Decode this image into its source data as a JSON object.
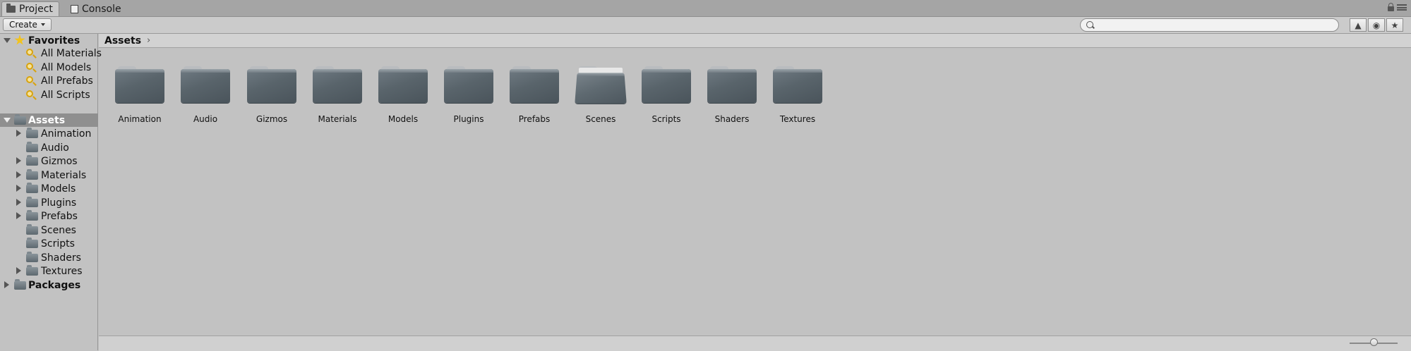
{
  "tabs": [
    {
      "label": "Project",
      "icon": "folder-icon",
      "active": true
    },
    {
      "label": "Console",
      "icon": "console-icon",
      "active": false
    }
  ],
  "toolbar": {
    "create_label": "Create",
    "search_placeholder": "",
    "search_value": ""
  },
  "tree": {
    "favorites": {
      "label": "Favorites",
      "items": [
        "All Materials",
        "All Models",
        "All Prefabs",
        "All Scripts"
      ]
    },
    "assets": {
      "label": "Assets",
      "children": [
        {
          "label": "Animation",
          "expandable": true
        },
        {
          "label": "Audio",
          "expandable": false
        },
        {
          "label": "Gizmos",
          "expandable": true
        },
        {
          "label": "Materials",
          "expandable": true
        },
        {
          "label": "Models",
          "expandable": true
        },
        {
          "label": "Plugins",
          "expandable": true
        },
        {
          "label": "Prefabs",
          "expandable": true
        },
        {
          "label": "Scenes",
          "expandable": false
        },
        {
          "label": "Scripts",
          "expandable": false
        },
        {
          "label": "Shaders",
          "expandable": false
        },
        {
          "label": "Textures",
          "expandable": true
        }
      ]
    },
    "packages": {
      "label": "Packages"
    }
  },
  "breadcrumb": {
    "path": "Assets",
    "arrow": "›"
  },
  "grid": {
    "folders": [
      "Animation",
      "Audio",
      "Gizmos",
      "Materials",
      "Models",
      "Plugins",
      "Prefabs",
      "Scenes",
      "Scripts",
      "Shaders",
      "Textures"
    ],
    "open_folder": "Scenes"
  },
  "footer": {
    "zoom": 0.5
  }
}
